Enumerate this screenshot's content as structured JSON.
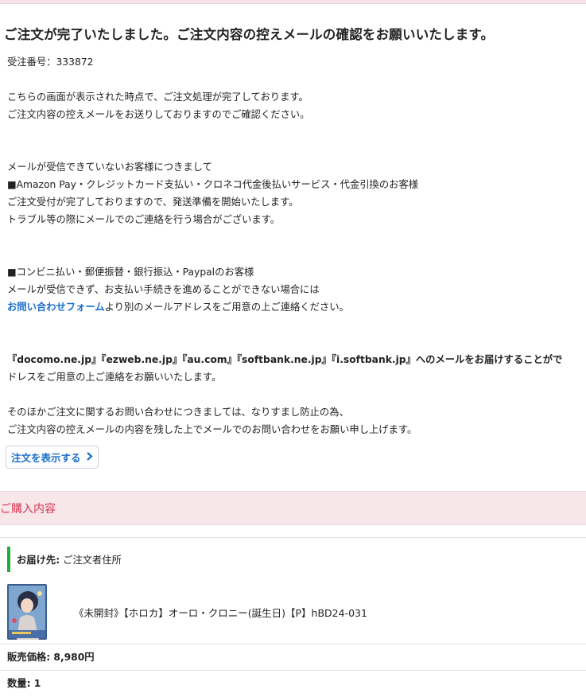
{
  "heading": "ご注文が完了いたしました。ご注文内容の控えメールの確認をお願いいたします。",
  "order_number": "受注番号：333872",
  "intro": [
    "こちらの画面が表示された時点で、ご注文処理が完了しております。",
    "ご注文内容の控えメールをお送りしておりますのでご確認ください。"
  ],
  "no_mail_section": {
    "title": "メールが受信できていないお客様につきまして",
    "amazon_header": "■Amazon Pay・クレジットカード支払い・クロネコ代金後払いサービス・代金引換のお客様",
    "amazon_lines": [
      "ご注文受付が完了しておりますので、発送準備を開始いたします。",
      "トラブル等の際にメールでのご連絡を行う場合がございます。"
    ],
    "convenience_header": "■コンビニ払い・郵便振替・銀行振込・Paypalのお客様",
    "convenience_line": "メールが受信できず、お支払い手続きを進めることができない場合には",
    "contact_link": "お問い合わせフォーム",
    "contact_suffix": "より別のメールアドレスをご用意の上ご連絡ください。"
  },
  "carrier_notice": {
    "bold_line": "『docomo.ne.jp』『ezweb.ne.jp』『au.com』『softbank.ne.jp』『i.softbank.jp』へのメールをお届けすることがで",
    "second_line": "ドレスをご用意の上ご連絡をお願いいたします。"
  },
  "other_inquiries": [
    "そのほかご注文に関するお問い合わせにつきましては、なりすまし防止の為、",
    "ご注文内容の控えメールの内容を残した上でメールでのお問い合わせをお願い申し上げます。"
  ],
  "show_order_button": "注文を表示する",
  "purchase_section": {
    "title": "ご購入内容",
    "delivery_label": "お届け先:",
    "delivery_value": "ご注文者住所",
    "item_name": "《未開封》【ホロカ】オーロ・クロニー(誕生日)【P】hBD24-031",
    "price": "販売価格: 8,980円",
    "quantity": "数量: 1"
  },
  "colors": {
    "accent_pink": "#d8344f",
    "link_blue": "#1a6fc9",
    "green_bar": "#1fae3c",
    "pink_bg": "#f7e6ea"
  },
  "icons": {
    "show_order": "chevron-right-icon",
    "item": "card-thumbnail"
  }
}
